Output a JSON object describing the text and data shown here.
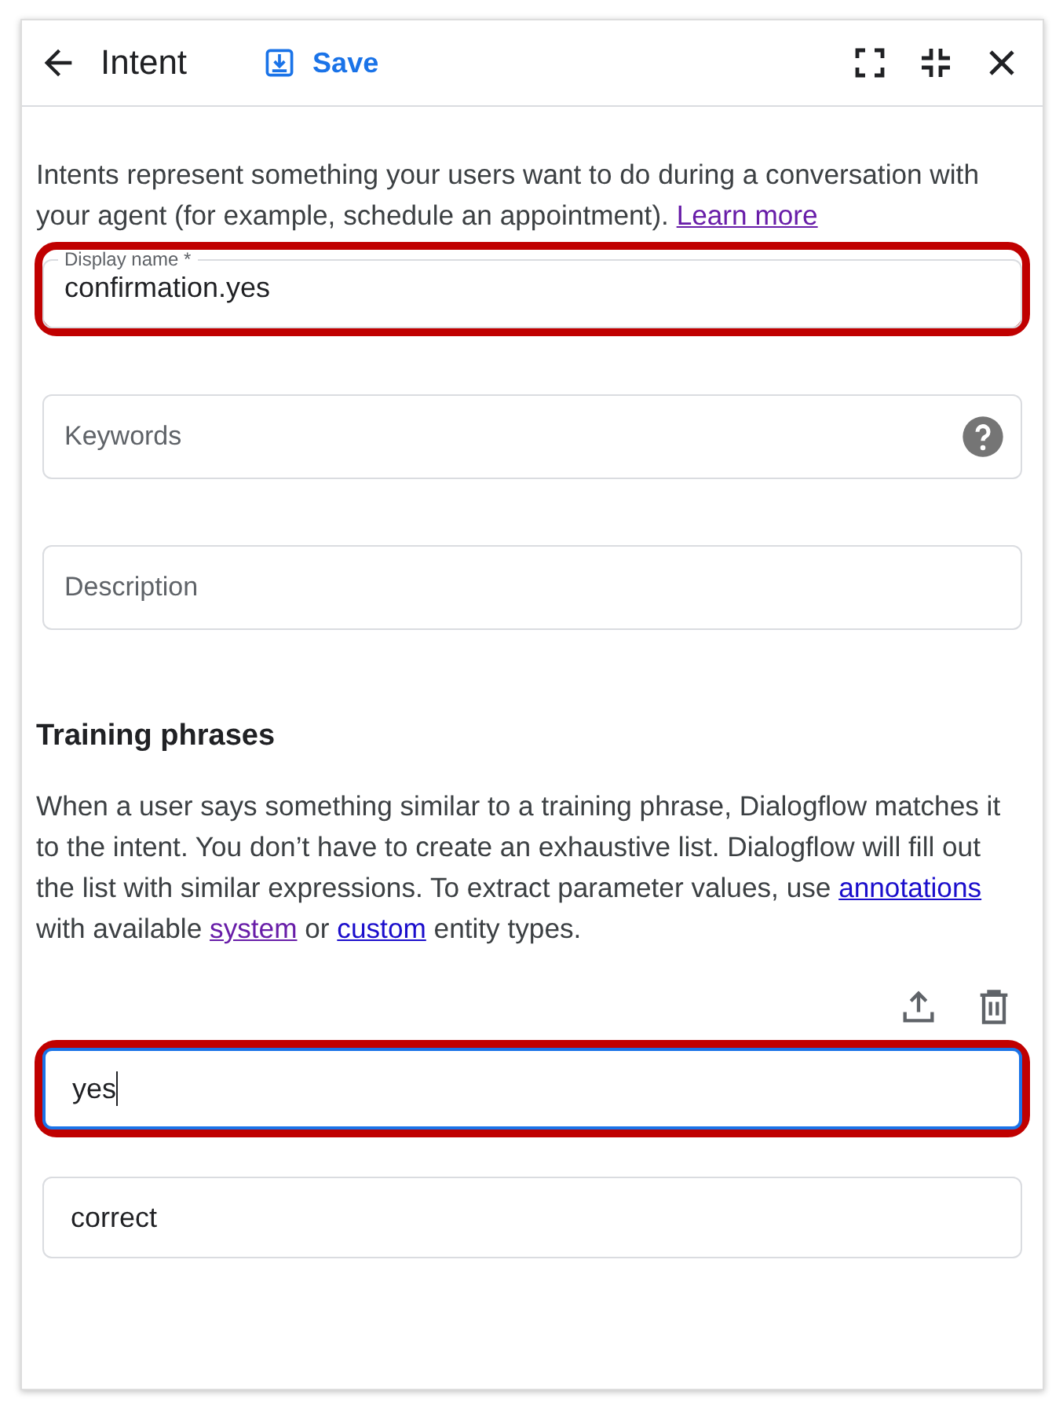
{
  "header": {
    "title": "Intent",
    "save_label": "Save"
  },
  "intro": [
    {
      "text": "Intents represent something your users want to do during a conversation with your agent (for example, schedule an appointment). "
    },
    {
      "link": "Learn more",
      "visited": true
    }
  ],
  "fields": [
    {
      "kind": "floating",
      "label": "Display name *",
      "value": "confirmation.yes",
      "highlighted": true
    },
    {
      "kind": "help",
      "placeholder": "Keywords",
      "highlighted": false
    },
    {
      "kind": "plain",
      "placeholder": "Description",
      "highlighted": false
    }
  ],
  "training": {
    "heading": "Training phrases",
    "description": [
      {
        "text": "When a user says something similar to a training phrase, Dialogflow matches it to the intent. You don’t have to create an exhaustive list. Dialogflow will fill out the list with similar expressions. To extract parameter values, use "
      },
      {
        "link": "annotations",
        "visited": false
      },
      {
        "text": " with available "
      },
      {
        "link": "system",
        "visited": true
      },
      {
        "text": " or "
      },
      {
        "link": "custom",
        "visited": false
      },
      {
        "text": " entity types."
      }
    ],
    "phrases": [
      {
        "value": "yes",
        "focused": true,
        "highlighted": true
      },
      {
        "value": "correct",
        "focused": false,
        "highlighted": false
      }
    ]
  }
}
